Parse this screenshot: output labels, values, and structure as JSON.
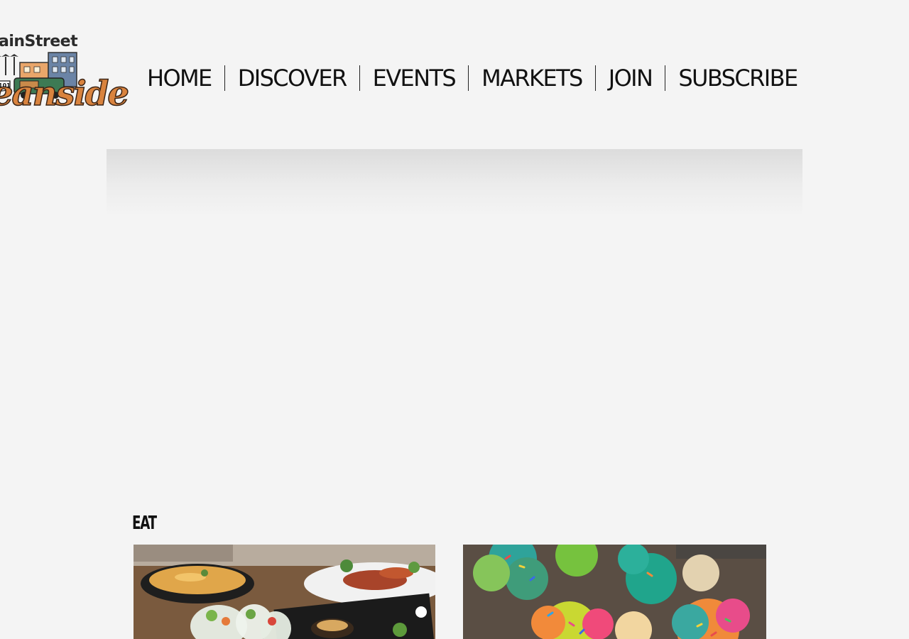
{
  "logo": {
    "top_text": "ainStreet",
    "script_text": "eanside",
    "route_badge": "101"
  },
  "nav": {
    "items": [
      {
        "label": "HOME"
      },
      {
        "label": "DISCOVER"
      },
      {
        "label": "EVENTS"
      },
      {
        "label": "MARKETS"
      },
      {
        "label": "JOIN"
      },
      {
        "label": "SUBSCRIBE"
      }
    ]
  },
  "main": {
    "section_title": "EAT",
    "cards": [
      {
        "image": "food-platter-spring-rolls-image"
      },
      {
        "image": "rainbow-cupcakes-image"
      }
    ]
  }
}
